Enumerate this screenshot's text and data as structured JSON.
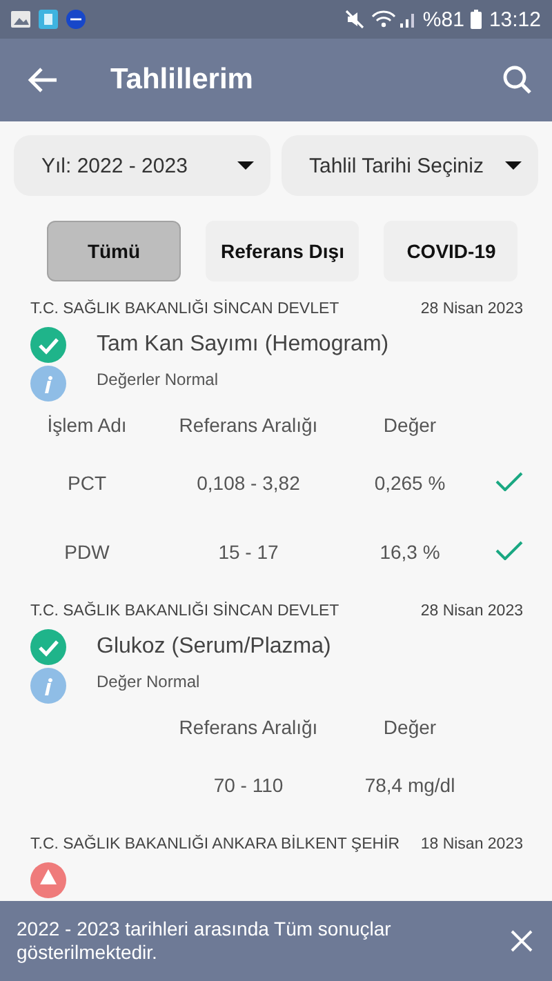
{
  "status_bar": {
    "battery": "%81",
    "time": "13:12"
  },
  "app_bar": {
    "title": "Tahlillerim"
  },
  "filters": [
    {
      "label": "Yıl: 2022 - 2023"
    },
    {
      "label": "Tahlil Tarihi Seçiniz"
    }
  ],
  "chips": [
    {
      "label": "Tümü",
      "selected": true
    },
    {
      "label": "Referans Dışı",
      "selected": false
    },
    {
      "label": "COVID-19",
      "selected": false
    }
  ],
  "results": [
    {
      "institution": "T.C. SAĞLIK BAKANLIĞI SİNCAN DEVLET",
      "date": "28 Nisan 2023",
      "kind": "normal",
      "title": "Tam Kan Sayımı (Hemogram)",
      "note": "Değerler Normal",
      "headers": {
        "name": "İşlem Adı",
        "range": "Referans Aralığı",
        "value": "Değer"
      },
      "rows": [
        {
          "name": "PCT",
          "range": "0,108 - 3,82",
          "value": "0,265 %",
          "in_range": true
        },
        {
          "name": "PDW",
          "range": "15 - 17",
          "value": "16,3 %",
          "in_range": true
        }
      ]
    },
    {
      "institution": "T.C. SAĞLIK BAKANLIĞI SİNCAN DEVLET",
      "date": "28 Nisan 2023",
      "kind": "normal",
      "title": "Glukoz (Serum/Plazma)",
      "note": "Değer Normal",
      "headers": {
        "range": "Referans Aralığı",
        "value": "Değer"
      },
      "rows": [
        {
          "range": "70 - 110",
          "value": "78,4 mg/dl"
        }
      ]
    },
    {
      "institution": "T.C. SAĞLIK BAKANLIĞI ANKARA BİLKENT ŞEHİR",
      "date": "18 Nisan 2023",
      "kind": "abnormal"
    }
  ],
  "snackbar": {
    "message": "2022 - 2023 tarihleri arasında Tüm sonuçlar gösterilmektedir."
  }
}
